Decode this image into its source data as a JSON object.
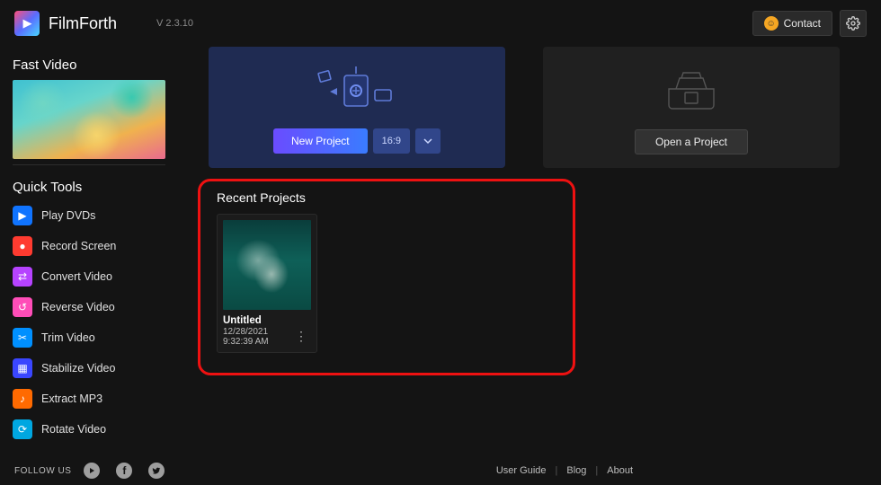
{
  "app": {
    "name": "FilmForth",
    "version": "V 2.3.10"
  },
  "header": {
    "contact_label": "Contact"
  },
  "sidebar": {
    "fast_video_title": "Fast Video",
    "quick_tools_title": "Quick Tools",
    "tools": [
      {
        "label": "Play DVDs",
        "icon_name": "play-icon",
        "color": "#1074ff"
      },
      {
        "label": "Record Screen",
        "icon_name": "record-icon",
        "color": "#ff3b30"
      },
      {
        "label": "Convert Video",
        "icon_name": "convert-icon",
        "color": "#b643ff"
      },
      {
        "label": "Reverse Video",
        "icon_name": "reverse-icon",
        "color": "#ff4db8"
      },
      {
        "label": "Trim Video",
        "icon_name": "trim-icon",
        "color": "#0090ff"
      },
      {
        "label": "Stabilize Video",
        "icon_name": "stabilize-icon",
        "color": "#3a46ff"
      },
      {
        "label": "Extract MP3",
        "icon_name": "audio-icon",
        "color": "#ff6a00"
      },
      {
        "label": "Rotate Video",
        "icon_name": "rotate-icon",
        "color": "#00a7e1"
      }
    ]
  },
  "panels": {
    "new_project_label": "New Project",
    "aspect_ratio": "16:9",
    "open_project_label": "Open a Project"
  },
  "recent": {
    "title": "Recent Projects",
    "projects": [
      {
        "name": "Untitled",
        "date": "12/28/2021 9:32:39 AM"
      }
    ]
  },
  "footer": {
    "follow": "Follow Us",
    "links": [
      "User Guide",
      "Blog",
      "About"
    ]
  }
}
